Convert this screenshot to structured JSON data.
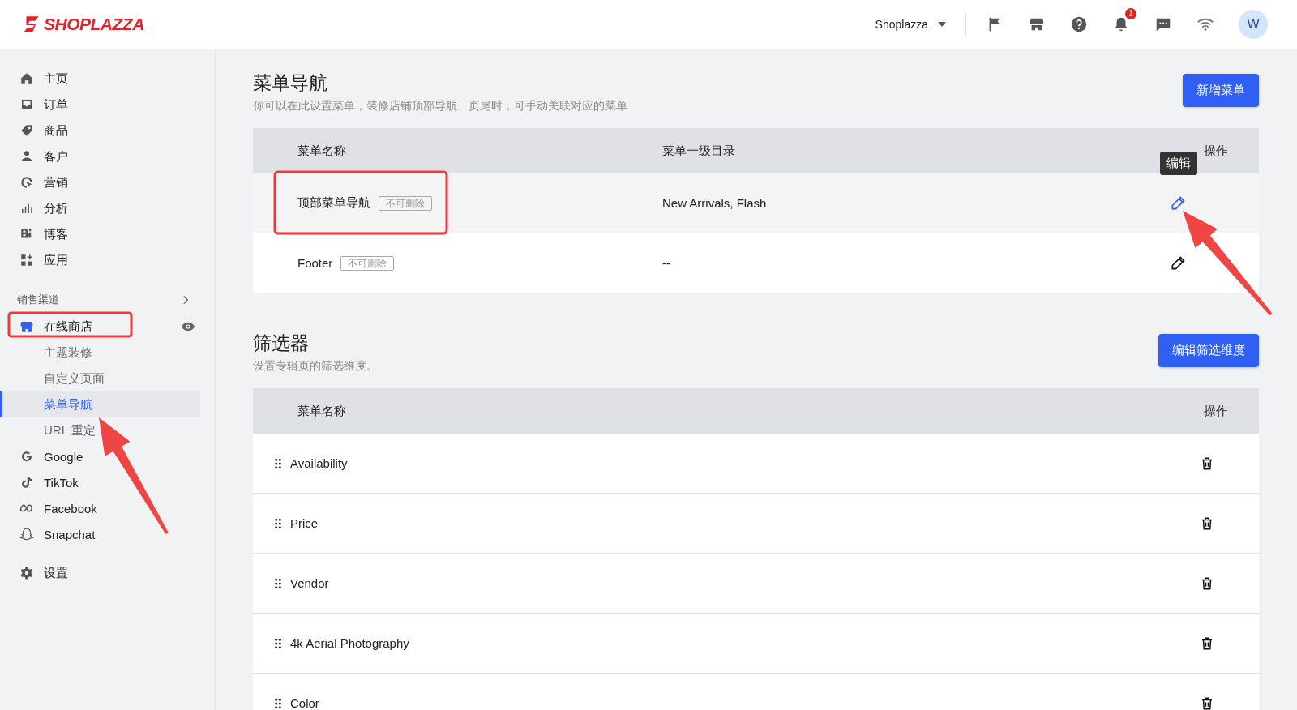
{
  "header": {
    "logo": "SHOPLAZZA",
    "store_switcher": "Shoplazza",
    "notification_count": "1",
    "avatar": "W"
  },
  "sidebar": {
    "items": [
      {
        "label": "主页"
      },
      {
        "label": "订单"
      },
      {
        "label": "商品"
      },
      {
        "label": "客户"
      },
      {
        "label": "营销"
      },
      {
        "label": "分析"
      },
      {
        "label": "博客"
      },
      {
        "label": "应用"
      }
    ],
    "channels_title": "销售渠道",
    "online_store": {
      "label": "在线商店",
      "children": [
        {
          "label": "主题装修",
          "selected": false
        },
        {
          "label": "自定义页面",
          "selected": false
        },
        {
          "label": "菜单导航",
          "selected": true
        },
        {
          "label": "URL 重定",
          "selected": false
        }
      ]
    },
    "channels": [
      {
        "label": "Google"
      },
      {
        "label": "TikTok"
      },
      {
        "label": "Facebook"
      },
      {
        "label": "Snapchat"
      }
    ],
    "settings": "设置"
  },
  "menu_section": {
    "title": "菜单导航",
    "description": "你可以在此设置菜单，装修店铺顶部导航、页尾时，可手动关联对应的菜单",
    "button": "新增菜单",
    "columns": [
      "菜单名称",
      "菜单一级目录",
      "操作"
    ],
    "rows": [
      {
        "name": "顶部菜单导航",
        "tag": "不可删除",
        "items": "New Arrivals, Flash",
        "hovered": true,
        "tooltip": "编辑"
      },
      {
        "name": "Footer",
        "tag": "不可删除",
        "items": "--",
        "hovered": false
      }
    ]
  },
  "filter_section": {
    "title": "筛选器",
    "description": "设置专辑页的筛选维度。",
    "button": "编辑筛选维度",
    "columns": [
      "菜单名称",
      "操作"
    ],
    "rows": [
      {
        "name": "Availability"
      },
      {
        "name": "Price"
      },
      {
        "name": "Vendor"
      },
      {
        "name": "4k Aerial Photography"
      },
      {
        "name": "Color"
      }
    ]
  }
}
